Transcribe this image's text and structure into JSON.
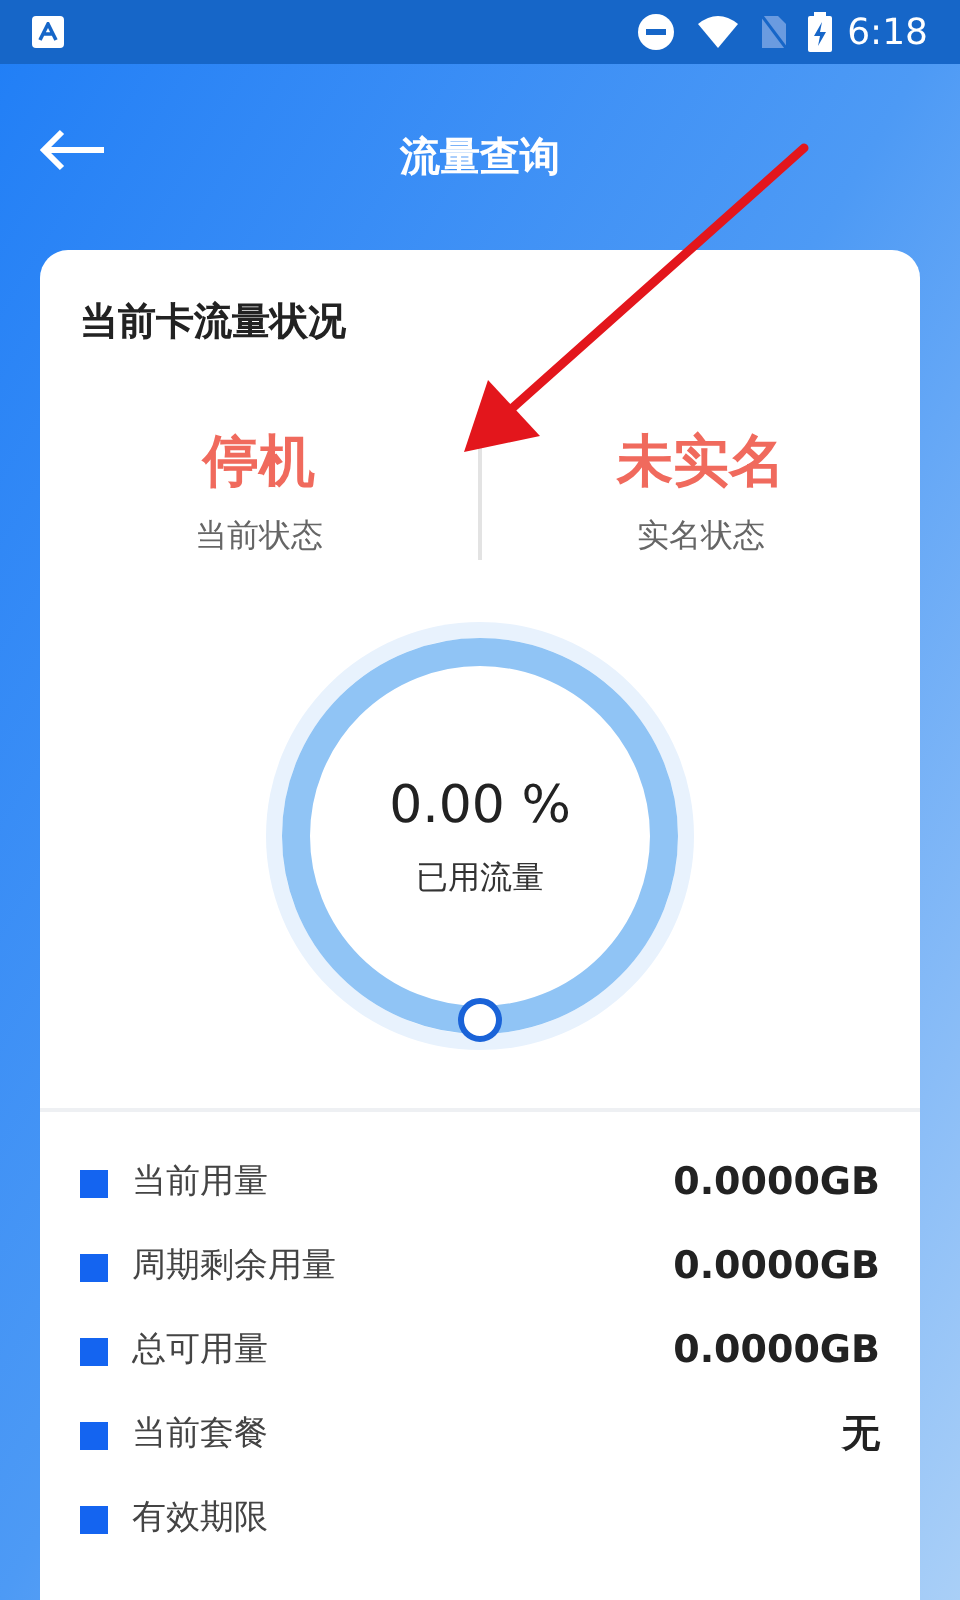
{
  "status_bar": {
    "time": "6:18"
  },
  "header": {
    "title": "流量查询"
  },
  "card": {
    "title": "当前卡流量状况",
    "states": [
      {
        "value": "停机",
        "label": "当前状态"
      },
      {
        "value": "未实名",
        "label": "实名状态"
      }
    ],
    "usage": {
      "reading": "0.00 %",
      "label": "已用流量"
    },
    "rows": [
      {
        "label": "当前用量",
        "value": "0.0000GB"
      },
      {
        "label": "周期剩余用量",
        "value": "0.0000GB"
      },
      {
        "label": "总可用量",
        "value": "0.0000GB"
      },
      {
        "label": "当前套餐",
        "value": "无"
      },
      {
        "label": "有效期限"
      }
    ]
  }
}
